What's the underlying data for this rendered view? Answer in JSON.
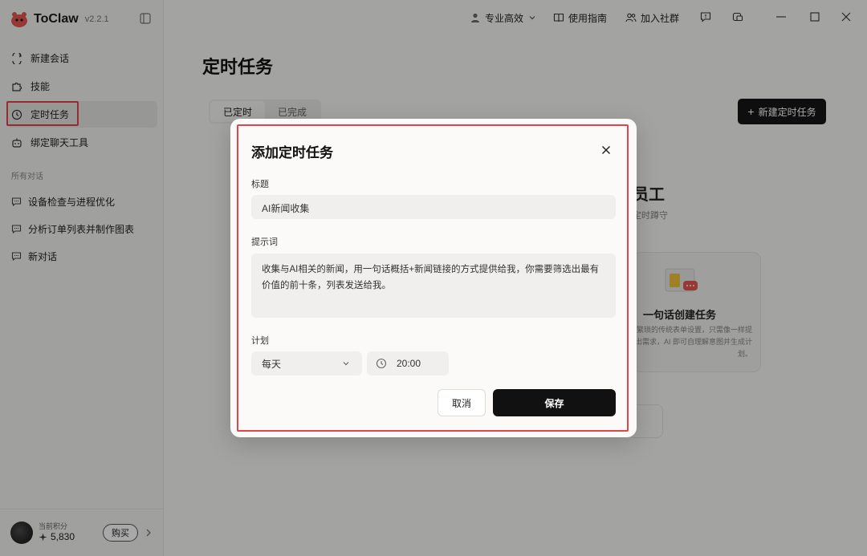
{
  "app": {
    "name": "ToClaw",
    "version": "v2.2.1"
  },
  "sidebar": {
    "nav": [
      {
        "label": "新建会话",
        "icon": "new-chat-icon"
      },
      {
        "label": "技能",
        "icon": "puzzle-icon"
      },
      {
        "label": "定时任务",
        "icon": "clock-icon"
      },
      {
        "label": "绑定聊天工具",
        "icon": "robot-icon"
      }
    ],
    "section_label": "所有对话",
    "conversations": [
      {
        "label": "设备检查与进程优化"
      },
      {
        "label": "分析订单列表并制作图表"
      },
      {
        "label": "新对话"
      }
    ],
    "points_label": "当前积分",
    "points_value": "5,830",
    "buy_label": "购买"
  },
  "topbar": {
    "mode_label": "专业高效",
    "guide_label": "使用指南",
    "community_label": "加入社群"
  },
  "main": {
    "title": "定时任务",
    "tabs": [
      {
        "label": "已定时"
      },
      {
        "label": "已完成"
      }
    ],
    "new_task_label": "新建定时任务",
    "bg_heading": "员工",
    "bg_sub": "定时蹲守",
    "bg_card_title": "一句话创建任务",
    "bg_card_desc": "繁琐的传统表单设置，只需像一样提出需求，AI 即可自理解意图并生成计划。"
  },
  "modal": {
    "title": "添加定时任务",
    "title_label": "标题",
    "title_value": "AI新闻收集",
    "prompt_label": "提示词",
    "prompt_value": "收集与AI相关的新闻，用一句话概括+新闻链接的方式提供给我，你需要筛选出最有价值的前十条，列表发送给我。",
    "plan_label": "计划",
    "frequency_value": "每天",
    "time_value": "20:00",
    "cancel_label": "取消",
    "save_label": "保存"
  },
  "colors": {
    "highlight": "#e0454b",
    "primary_button": "#111111",
    "brand": "#e2574c"
  }
}
